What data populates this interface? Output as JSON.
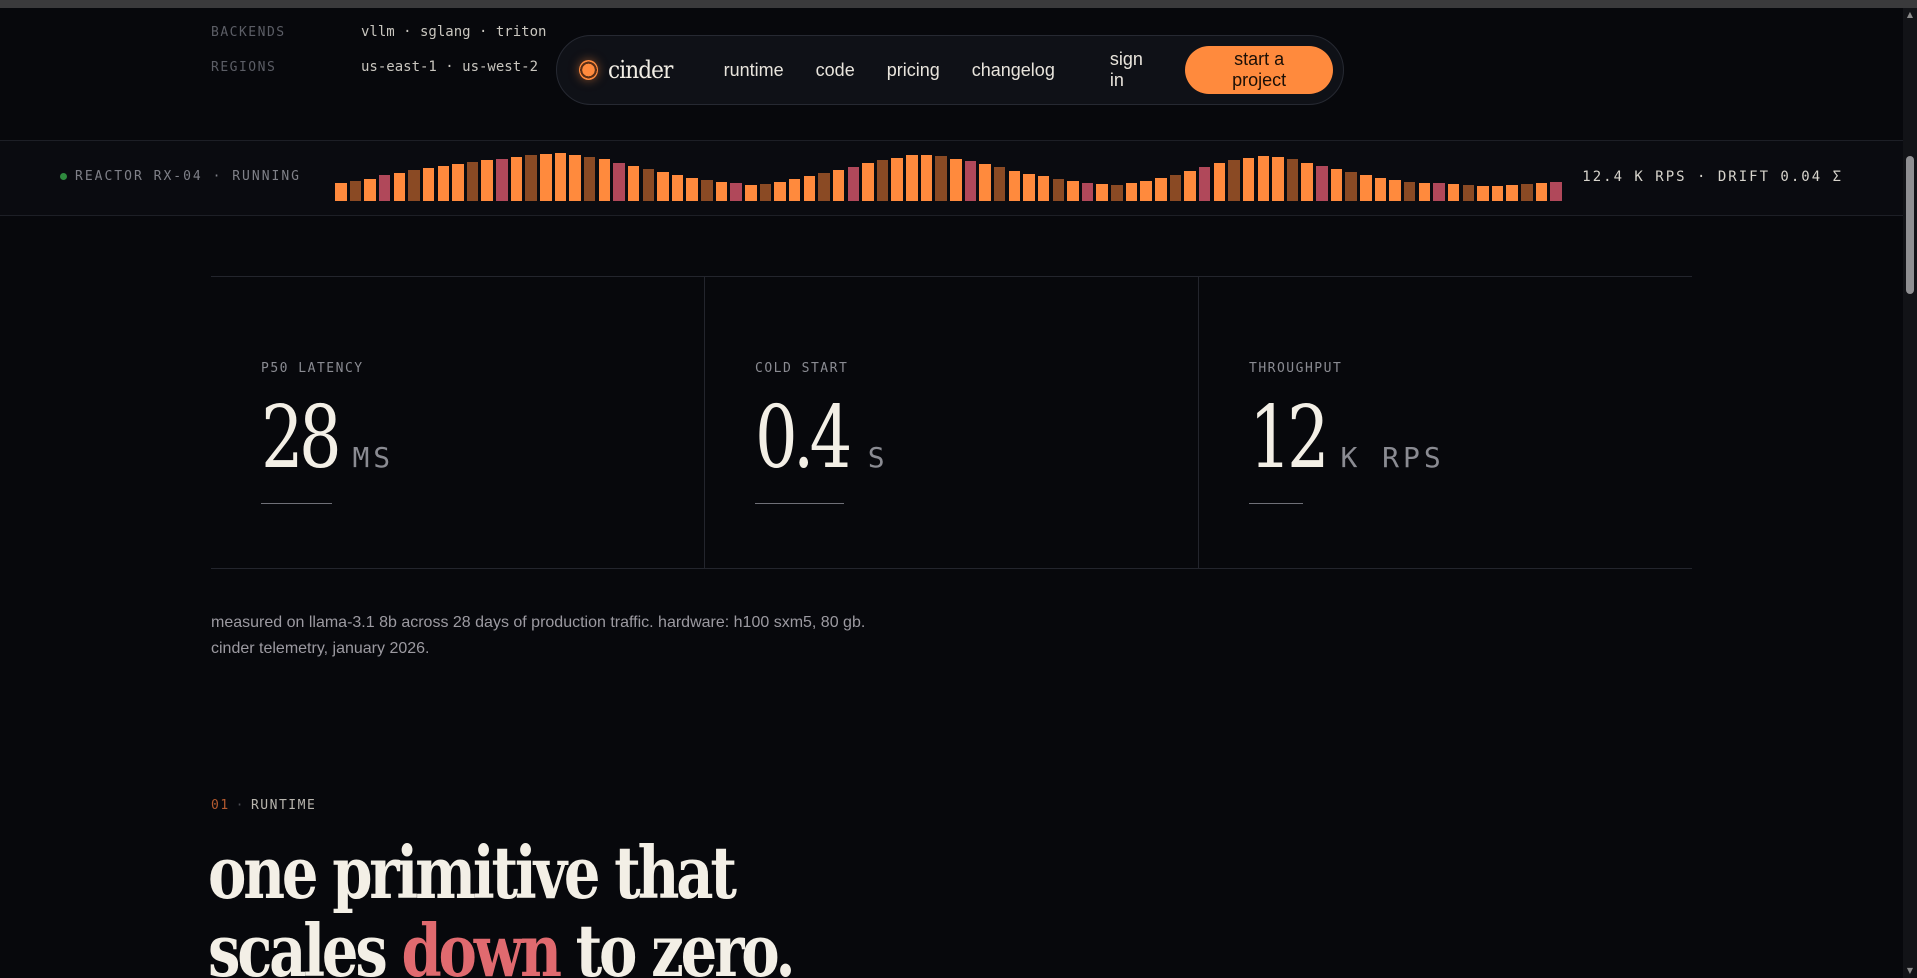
{
  "meta": {
    "backends_label": "BACKENDS",
    "backends_value": "vllm · sglang · triton",
    "regions_label": "REGIONS",
    "regions_value": "us-east-1 · us-west-2"
  },
  "nav": {
    "brand": "cinder",
    "links": [
      "runtime",
      "code",
      "pricing",
      "changelog"
    ],
    "sign_in": "sign in",
    "cta": "start a project"
  },
  "reactor": {
    "status": "REACTOR RX-04 · RUNNING",
    "metric": "12.4 K RPS · DRIFT 0.04 Σ",
    "bar_levels": [
      0.25,
      0.3,
      0.35,
      0.45,
      0.5,
      0.58,
      0.62,
      0.68,
      0.72,
      0.78,
      0.82,
      0.86,
      0.9,
      0.94,
      0.98,
      1.0,
      0.96,
      0.9,
      0.84,
      0.76,
      0.68,
      0.6,
      0.52,
      0.45,
      0.38,
      0.32,
      0.28,
      0.24,
      0.2,
      0.22,
      0.28,
      0.35,
      0.42,
      0.5,
      0.58,
      0.66,
      0.74,
      0.82,
      0.88,
      0.94,
      0.96,
      0.92,
      0.86,
      0.8,
      0.72,
      0.64,
      0.56,
      0.48,
      0.42,
      0.36,
      0.3,
      0.26,
      0.22,
      0.2,
      0.24,
      0.3,
      0.38,
      0.46,
      0.56,
      0.66,
      0.74,
      0.82,
      0.88,
      0.92,
      0.9,
      0.84,
      0.76,
      0.68,
      0.6,
      0.52,
      0.45,
      0.38,
      0.32,
      0.28,
      0.26,
      0.24,
      0.22,
      0.2,
      0.18,
      0.18,
      0.2,
      0.22,
      0.24,
      0.28
    ],
    "colors": {
      "orange": "#ff8a3d",
      "brown": "#8a4a24",
      "rose": "#b0485a"
    }
  },
  "stats": [
    {
      "label": "P50 LATENCY",
      "value": "28",
      "unit": "MS"
    },
    {
      "label": "COLD START",
      "value": "0.4",
      "unit": "S"
    },
    {
      "label": "THROUGHPUT",
      "value": "12",
      "unit": "K RPS"
    }
  ],
  "caption": "measured on llama-3.1 8b across 28 days of production traffic. hardware: h100 sxm5, 80 gb. cinder telemetry, january 2026.",
  "section": {
    "number": "01",
    "name": "RUNTIME",
    "headline_line1": "one primitive that",
    "headline_line2_pre": "scales ",
    "headline_accent": "down",
    "headline_line2_post": " to zero."
  }
}
